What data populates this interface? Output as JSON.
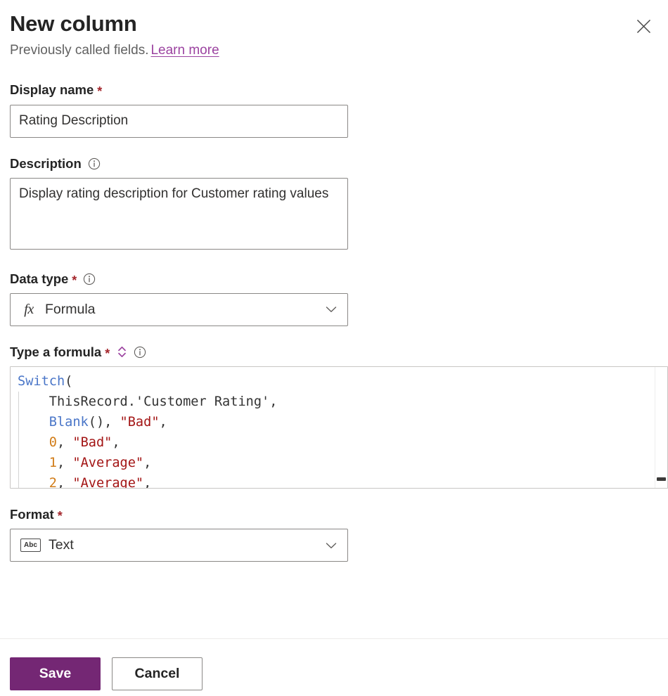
{
  "header": {
    "title": "New column",
    "subtitle_text": "Previously called fields.",
    "learn_more_label": "Learn more",
    "close_icon": "close-icon"
  },
  "fields": {
    "display_name": {
      "label": "Display name",
      "required_marker": "*",
      "value": "Rating Description",
      "placeholder": ""
    },
    "description": {
      "label": "Description",
      "info_icon": "info-icon",
      "value": "Display rating description for Customer rating values",
      "placeholder": ""
    },
    "data_type": {
      "label": "Data type",
      "required_marker": "*",
      "info_icon": "info-icon",
      "value": "Formula",
      "value_icon": "fx-icon",
      "chevron_icon": "chevron-down-icon"
    },
    "formula": {
      "label": "Type a formula",
      "required_marker": "*",
      "expand_icon": "chevron-up-down-icon",
      "info_icon": "info-icon",
      "lines": [
        [
          {
            "t": "Switch",
            "k": "fn"
          },
          {
            "t": "(",
            "k": "punct"
          }
        ],
        [
          {
            "t": "    ThisRecord.",
            "k": "plain"
          },
          {
            "t": "'Customer Rating'",
            "k": "plain"
          },
          {
            "t": ",",
            "k": "punct"
          }
        ],
        [
          {
            "t": "    ",
            "k": "plain"
          },
          {
            "t": "Blank",
            "k": "fn"
          },
          {
            "t": "(), ",
            "k": "punct"
          },
          {
            "t": "\"Bad\"",
            "k": "str"
          },
          {
            "t": ",",
            "k": "punct"
          }
        ],
        [
          {
            "t": "    ",
            "k": "plain"
          },
          {
            "t": "0",
            "k": "num"
          },
          {
            "t": ", ",
            "k": "punct"
          },
          {
            "t": "\"Bad\"",
            "k": "str"
          },
          {
            "t": ",",
            "k": "punct"
          }
        ],
        [
          {
            "t": "    ",
            "k": "plain"
          },
          {
            "t": "1",
            "k": "num"
          },
          {
            "t": ", ",
            "k": "punct"
          },
          {
            "t": "\"Average\"",
            "k": "str"
          },
          {
            "t": ",",
            "k": "punct"
          }
        ],
        [
          {
            "t": "    ",
            "k": "plain"
          },
          {
            "t": "2",
            "k": "num"
          },
          {
            "t": ", ",
            "k": "punct"
          },
          {
            "t": "\"Average\"",
            "k": "str"
          },
          {
            "t": ",",
            "k": "punct"
          }
        ]
      ]
    },
    "format": {
      "label": "Format",
      "required_marker": "*",
      "value": "Text",
      "value_icon": "abc-icon",
      "value_icon_text": "Abc",
      "chevron_icon": "chevron-down-icon"
    }
  },
  "footer": {
    "save_label": "Save",
    "cancel_label": "Cancel"
  },
  "colors": {
    "accent_purple": "#742774",
    "link_purple": "#9b43a0",
    "required_red": "#a4262c",
    "code_function": "#4a76c8",
    "code_string": "#a31515",
    "code_number": "#d17c18"
  }
}
